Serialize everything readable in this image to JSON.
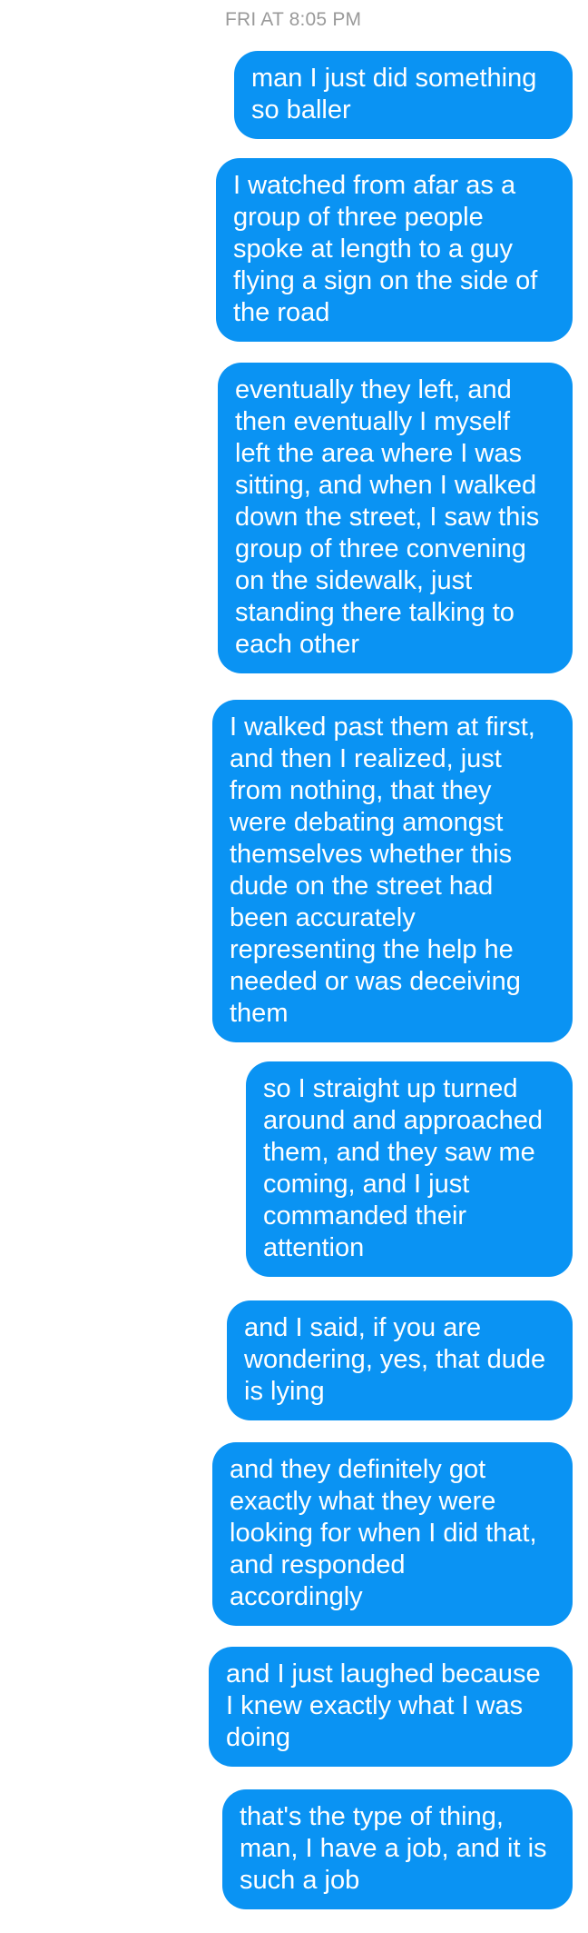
{
  "conversation": {
    "timestamp": "FRI AT 8:05 PM",
    "bubble_color": "#0a93f3",
    "messages": [
      "man I just did something\nso baller",
      "I watched from afar as a\ngroup of three people\nspoke at length to a guy\nflying a sign on the side of\nthe road",
      "eventually they left, and\nthen eventually I myself\nleft the area where I was\nsitting, and when I walked\ndown the street, I saw this\ngroup of three convening\non the sidewalk, just\nstanding there talking to\neach other",
      "I walked past them at first,\nand then I realized, just\nfrom nothing, that they\nwere debating amongst\nthemselves whether this\ndude on the street had\nbeen accurately\nrepresenting the help he\nneeded or was deceiving\nthem",
      "so I straight up turned\naround and approached\nthem, and they saw me\ncoming, and I just\ncommanded their\nattention",
      "and I said, if you are\nwondering, yes, that dude\nis lying",
      "and they definitely got\nexactly what they were\nlooking for when I did that,\nand responded\naccordingly",
      "and I just laughed because\nI knew exactly what I was\ndoing",
      "that's the type of thing,\nman, I have a job, and it is\nsuch a job"
    ]
  }
}
